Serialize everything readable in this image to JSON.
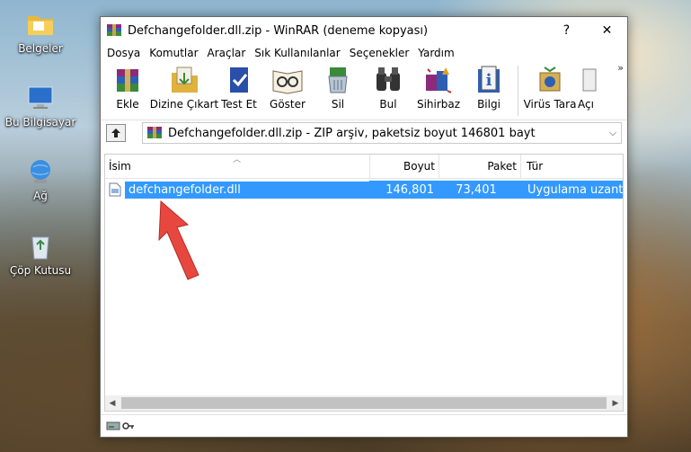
{
  "desktop": {
    "icons": [
      {
        "name": "folder-icon",
        "label": "Belgeler"
      },
      {
        "name": "computer-icon",
        "label": "Bu Bilgisayar"
      },
      {
        "name": "network-icon",
        "label": "Ağ"
      },
      {
        "name": "recycle-bin-icon",
        "label": "Çöp Kutusu"
      }
    ]
  },
  "window": {
    "title": "Defchangefolder.dll.zip - WinRAR (deneme kopyası)",
    "help_label": "?",
    "close_label": "✕"
  },
  "menu": [
    "Dosya",
    "Komutlar",
    "Araçlar",
    "Sık Kullanılanlar",
    "Seçenekler",
    "Yardım"
  ],
  "toolbar": {
    "tools": [
      {
        "label": "Ekle",
        "icon": "add-archive-icon"
      },
      {
        "label": "Dizine Çıkart",
        "icon": "extract-icon"
      },
      {
        "label": "Test Et",
        "icon": "test-icon"
      },
      {
        "label": "Göster",
        "icon": "view-icon"
      },
      {
        "label": "Sil",
        "icon": "delete-icon"
      },
      {
        "label": "Bul",
        "icon": "find-icon"
      },
      {
        "label": "Sihirbaz",
        "icon": "wizard-icon"
      },
      {
        "label": "Bilgi",
        "icon": "info-icon"
      },
      {
        "label": "Virüs Tara",
        "icon": "virus-scan-icon"
      },
      {
        "label": "Açı",
        "icon": "comment-icon"
      }
    ],
    "more": "»"
  },
  "address": {
    "path": "Defchangefolder.dll.zip - ZIP arşiv, paketsiz boyut 146801 bayt"
  },
  "columns": {
    "name": "İsim",
    "size": "Boyut",
    "packed": "Paket",
    "type": "Tür"
  },
  "files": [
    {
      "name": "defchangefolder.dll",
      "size": "146,801",
      "packed": "73,401",
      "type": "Uygulama uzantısı",
      "selected": true
    }
  ]
}
